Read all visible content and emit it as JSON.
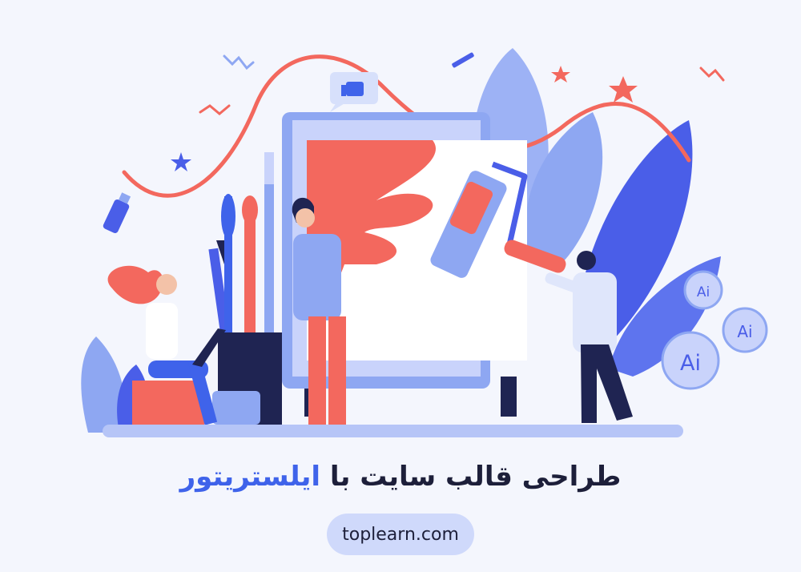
{
  "title": {
    "main": "طراحی قالب سایت با",
    "accent": "ایلستریتور"
  },
  "badges": [
    "Ai",
    "Ai",
    "Ai"
  ],
  "site": {
    "url": "toplearn.com"
  },
  "colors": {
    "accent": "#3f63ea",
    "coral": "#f3685e",
    "lavender": "#8ea7f2",
    "navy": "#1f2452",
    "background": "#f4f6fd"
  }
}
